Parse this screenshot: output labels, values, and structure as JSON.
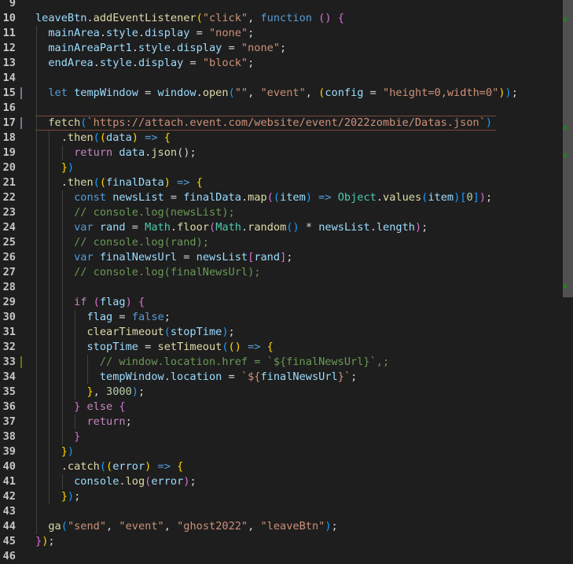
{
  "editor": {
    "colors": {
      "background": "#1e1e1e",
      "modified_gutter": "#6b7b8c",
      "added_gutter": "#587c0c",
      "scroll_marker": "#2a7a2a"
    },
    "lines": [
      {
        "n": "9",
        "tokens": []
      },
      {
        "n": "10",
        "tokens": [
          [
            "leaveBtn",
            "var"
          ],
          [
            ".",
            "plain"
          ],
          [
            "addEventListener",
            "fn"
          ],
          [
            "(",
            "p1"
          ],
          [
            "\"click\"",
            "str"
          ],
          [
            ", ",
            "plain"
          ],
          [
            "function",
            "kw"
          ],
          [
            " ",
            "plain"
          ],
          [
            "()",
            "p2"
          ],
          [
            " ",
            "plain"
          ],
          [
            "{",
            "p2"
          ]
        ]
      },
      {
        "n": "11",
        "tokens": [
          [
            "  mainArea",
            "var"
          ],
          [
            ".",
            "plain"
          ],
          [
            "style",
            "var"
          ],
          [
            ".",
            "plain"
          ],
          [
            "display",
            "var"
          ],
          [
            " = ",
            "plain"
          ],
          [
            "\"none\"",
            "str"
          ],
          [
            ";",
            "plain"
          ]
        ]
      },
      {
        "n": "12",
        "tokens": [
          [
            "  mainAreaPart1",
            "var"
          ],
          [
            ".",
            "plain"
          ],
          [
            "style",
            "var"
          ],
          [
            ".",
            "plain"
          ],
          [
            "display",
            "var"
          ],
          [
            " = ",
            "plain"
          ],
          [
            "\"none\"",
            "str"
          ],
          [
            ";",
            "plain"
          ]
        ]
      },
      {
        "n": "13",
        "tokens": [
          [
            "  endArea",
            "var"
          ],
          [
            ".",
            "plain"
          ],
          [
            "style",
            "var"
          ],
          [
            ".",
            "plain"
          ],
          [
            "display",
            "var"
          ],
          [
            " = ",
            "plain"
          ],
          [
            "\"block\"",
            "str"
          ],
          [
            ";",
            "plain"
          ]
        ]
      },
      {
        "n": "14",
        "tokens": []
      },
      {
        "n": "15",
        "gutter": "modified",
        "tokens": [
          [
            "  let",
            "kw"
          ],
          [
            " ",
            "plain"
          ],
          [
            "tempWindow",
            "var"
          ],
          [
            " = ",
            "plain"
          ],
          [
            "window",
            "var"
          ],
          [
            ".",
            "plain"
          ],
          [
            "open",
            "fn"
          ],
          [
            "(",
            "p3"
          ],
          [
            "\"\"",
            "str"
          ],
          [
            ", ",
            "plain"
          ],
          [
            "\"event\"",
            "str"
          ],
          [
            ", ",
            "plain"
          ],
          [
            "(",
            "p1"
          ],
          [
            "config",
            "var"
          ],
          [
            " = ",
            "plain"
          ],
          [
            "\"height=0,width=0\"",
            "str"
          ],
          [
            ")",
            "p1"
          ],
          [
            ")",
            "p3"
          ],
          [
            ";",
            "plain"
          ]
        ]
      },
      {
        "n": "16",
        "tokens": []
      },
      {
        "n": "17",
        "current": true,
        "gutter": "modified",
        "tokens": [
          [
            "  fetch",
            "fn"
          ],
          [
            "(",
            "p3"
          ],
          [
            "`https://attach.event.com/website/event/2022zombie/Datas.json`",
            "str"
          ],
          [
            ")",
            "p3"
          ]
        ]
      },
      {
        "n": "18",
        "tokens": [
          [
            "    .",
            "plain"
          ],
          [
            "then",
            "fn"
          ],
          [
            "(",
            "p3"
          ],
          [
            "(",
            "p1"
          ],
          [
            "data",
            "var"
          ],
          [
            ")",
            "p1"
          ],
          [
            " => ",
            "kw"
          ],
          [
            "{",
            "p1"
          ]
        ]
      },
      {
        "n": "19",
        "tokens": [
          [
            "      return",
            "ctl"
          ],
          [
            " ",
            "plain"
          ],
          [
            "data",
            "var"
          ],
          [
            ".",
            "plain"
          ],
          [
            "json",
            "fn"
          ],
          [
            "();",
            "plain"
          ]
        ]
      },
      {
        "n": "20",
        "tokens": [
          [
            "    }",
            "p1"
          ],
          [
            ")",
            "p3"
          ]
        ]
      },
      {
        "n": "21",
        "tokens": [
          [
            "    .",
            "plain"
          ],
          [
            "then",
            "fn"
          ],
          [
            "(",
            "p3"
          ],
          [
            "(",
            "p1"
          ],
          [
            "finalData",
            "var"
          ],
          [
            ")",
            "p1"
          ],
          [
            " => ",
            "kw"
          ],
          [
            "{",
            "p1"
          ]
        ]
      },
      {
        "n": "22",
        "tokens": [
          [
            "      const",
            "kw"
          ],
          [
            " ",
            "plain"
          ],
          [
            "newsList",
            "var"
          ],
          [
            " = ",
            "plain"
          ],
          [
            "finalData",
            "var"
          ],
          [
            ".",
            "plain"
          ],
          [
            "map",
            "fn"
          ],
          [
            "(",
            "p2"
          ],
          [
            "(",
            "p3"
          ],
          [
            "item",
            "var"
          ],
          [
            ")",
            "p3"
          ],
          [
            " => ",
            "kw"
          ],
          [
            "Object",
            "cls"
          ],
          [
            ".",
            "plain"
          ],
          [
            "values",
            "fn"
          ],
          [
            "(",
            "p3"
          ],
          [
            "item",
            "var"
          ],
          [
            ")",
            "p3"
          ],
          [
            "[",
            "p3"
          ],
          [
            "0",
            "num"
          ],
          [
            "]",
            "p3"
          ],
          [
            ")",
            "p2"
          ],
          [
            ";",
            "plain"
          ]
        ]
      },
      {
        "n": "23",
        "tokens": [
          [
            "      // console.log(newsList);",
            "cmt"
          ]
        ]
      },
      {
        "n": "24",
        "tokens": [
          [
            "      var",
            "kw"
          ],
          [
            " ",
            "plain"
          ],
          [
            "rand",
            "var"
          ],
          [
            " = ",
            "plain"
          ],
          [
            "Math",
            "cls"
          ],
          [
            ".",
            "plain"
          ],
          [
            "floor",
            "fn"
          ],
          [
            "(",
            "p2"
          ],
          [
            "Math",
            "cls"
          ],
          [
            ".",
            "plain"
          ],
          [
            "random",
            "fn"
          ],
          [
            "()",
            "p3"
          ],
          [
            " * ",
            "plain"
          ],
          [
            "newsList",
            "var"
          ],
          [
            ".",
            "plain"
          ],
          [
            "length",
            "var"
          ],
          [
            ")",
            "p2"
          ],
          [
            ";",
            "plain"
          ]
        ]
      },
      {
        "n": "25",
        "tokens": [
          [
            "      // console.log(rand);",
            "cmt"
          ]
        ]
      },
      {
        "n": "26",
        "tokens": [
          [
            "      var",
            "kw"
          ],
          [
            " ",
            "plain"
          ],
          [
            "finalNewsUrl",
            "var"
          ],
          [
            " = ",
            "plain"
          ],
          [
            "newsList",
            "var"
          ],
          [
            "[",
            "p2"
          ],
          [
            "rand",
            "var"
          ],
          [
            "]",
            "p2"
          ],
          [
            ";",
            "plain"
          ]
        ]
      },
      {
        "n": "27",
        "tokens": [
          [
            "      // console.log(finalNewsUrl);",
            "cmt"
          ]
        ]
      },
      {
        "n": "28",
        "tokens": []
      },
      {
        "n": "29",
        "tokens": [
          [
            "      if",
            "ctl"
          ],
          [
            " ",
            "plain"
          ],
          [
            "(",
            "p2"
          ],
          [
            "flag",
            "var"
          ],
          [
            ")",
            "p2"
          ],
          [
            " ",
            "plain"
          ],
          [
            "{",
            "p2"
          ]
        ]
      },
      {
        "n": "30",
        "tokens": [
          [
            "        flag",
            "var"
          ],
          [
            " = ",
            "plain"
          ],
          [
            "false",
            "kw"
          ],
          [
            ";",
            "plain"
          ]
        ]
      },
      {
        "n": "31",
        "tokens": [
          [
            "        clearTimeout",
            "fn"
          ],
          [
            "(",
            "p3"
          ],
          [
            "stopTime",
            "var"
          ],
          [
            ")",
            "p3"
          ],
          [
            ";",
            "plain"
          ]
        ]
      },
      {
        "n": "32",
        "tokens": [
          [
            "        stopTime",
            "var"
          ],
          [
            " = ",
            "plain"
          ],
          [
            "setTimeout",
            "fn"
          ],
          [
            "(",
            "p3"
          ],
          [
            "()",
            "p1"
          ],
          [
            " => ",
            "kw"
          ],
          [
            "{",
            "p1"
          ]
        ]
      },
      {
        "n": "33",
        "gutter": "added",
        "tokens": [
          [
            "          // window.location.href = `${finalNewsUrl}`,;",
            "cmt"
          ]
        ]
      },
      {
        "n": "34",
        "tokens": [
          [
            "          tempWindow",
            "var"
          ],
          [
            ".",
            "plain"
          ],
          [
            "location",
            "var"
          ],
          [
            " = ",
            "plain"
          ],
          [
            "`${",
            "str"
          ],
          [
            "finalNewsUrl",
            "var"
          ],
          [
            "}`",
            "str"
          ],
          [
            ";",
            "plain"
          ]
        ]
      },
      {
        "n": "35",
        "tokens": [
          [
            "        }",
            "p1"
          ],
          [
            ", ",
            "plain"
          ],
          [
            "3000",
            "num"
          ],
          [
            ")",
            "p3"
          ],
          [
            ";",
            "plain"
          ]
        ]
      },
      {
        "n": "36",
        "tokens": [
          [
            "      }",
            "p2"
          ],
          [
            " ",
            "plain"
          ],
          [
            "else",
            "ctl"
          ],
          [
            " ",
            "plain"
          ],
          [
            "{",
            "p2"
          ]
        ]
      },
      {
        "n": "37",
        "tokens": [
          [
            "        return",
            "ctl"
          ],
          [
            ";",
            "plain"
          ]
        ]
      },
      {
        "n": "38",
        "tokens": [
          [
            "      }",
            "p2"
          ]
        ]
      },
      {
        "n": "39",
        "tokens": [
          [
            "    }",
            "p1"
          ],
          [
            ")",
            "p3"
          ]
        ]
      },
      {
        "n": "40",
        "tokens": [
          [
            "    .",
            "plain"
          ],
          [
            "catch",
            "fn"
          ],
          [
            "(",
            "p3"
          ],
          [
            "(",
            "p1"
          ],
          [
            "error",
            "var"
          ],
          [
            ")",
            "p1"
          ],
          [
            " => ",
            "kw"
          ],
          [
            "{",
            "p1"
          ]
        ]
      },
      {
        "n": "41",
        "tokens": [
          [
            "      console",
            "var"
          ],
          [
            ".",
            "plain"
          ],
          [
            "log",
            "fn"
          ],
          [
            "(",
            "p2"
          ],
          [
            "error",
            "var"
          ],
          [
            ")",
            "p2"
          ],
          [
            ";",
            "plain"
          ]
        ]
      },
      {
        "n": "42",
        "tokens": [
          [
            "    }",
            "p1"
          ],
          [
            ")",
            "p3"
          ],
          [
            ";",
            "plain"
          ]
        ]
      },
      {
        "n": "43",
        "tokens": []
      },
      {
        "n": "44",
        "tokens": [
          [
            "  ga",
            "fn"
          ],
          [
            "(",
            "p3"
          ],
          [
            "\"send\"",
            "str"
          ],
          [
            ", ",
            "plain"
          ],
          [
            "\"event\"",
            "str"
          ],
          [
            ", ",
            "plain"
          ],
          [
            "\"ghost2022\"",
            "str"
          ],
          [
            ", ",
            "plain"
          ],
          [
            "\"leaveBtn\"",
            "str"
          ],
          [
            ")",
            "p3"
          ],
          [
            ";",
            "plain"
          ]
        ]
      },
      {
        "n": "45",
        "tokens": [
          [
            "}",
            "p2"
          ],
          [
            ")",
            "p1"
          ],
          [
            ";",
            "plain"
          ]
        ]
      },
      {
        "n": "46",
        "tokens": []
      }
    ]
  }
}
